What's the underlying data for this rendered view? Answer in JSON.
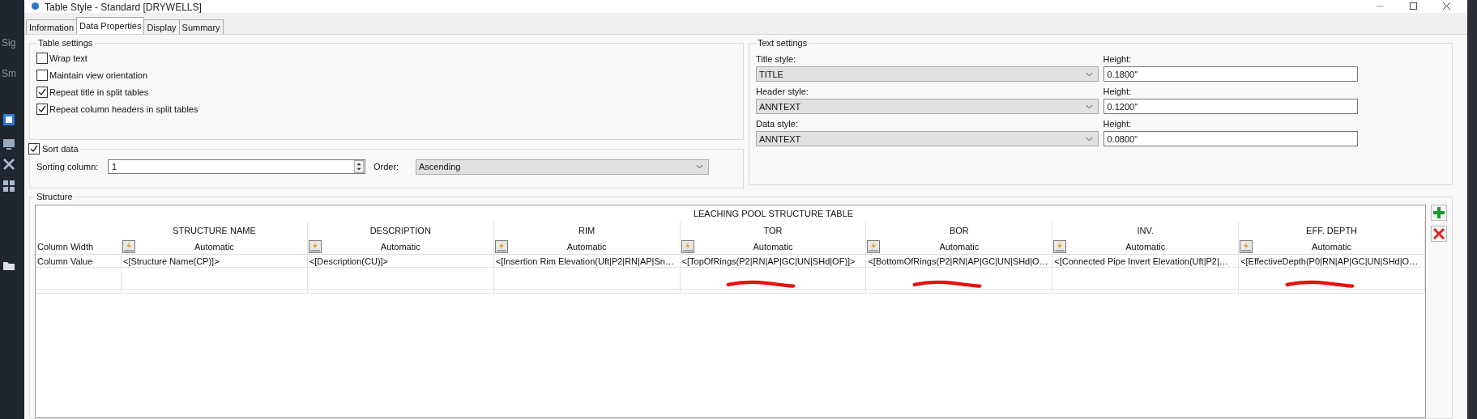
{
  "background_app": {
    "labels": [
      "Sig",
      "Sm"
    ]
  },
  "window": {
    "title": "Table Style - Standard [DRYWELLS]"
  },
  "tabs": [
    {
      "label": "Information",
      "selected": false
    },
    {
      "label": "Data Properties",
      "selected": true
    },
    {
      "label": "Display",
      "selected": false
    },
    {
      "label": "Summary",
      "selected": false
    }
  ],
  "table_settings": {
    "title": "Table settings",
    "options": [
      {
        "label": "Wrap text",
        "checked": false
      },
      {
        "label": "Maintain view orientation",
        "checked": false
      },
      {
        "label": "Repeat title in split tables",
        "checked": true
      },
      {
        "label": "Repeat column headers in split tables",
        "checked": true
      }
    ]
  },
  "sort_data": {
    "label": "Sort data",
    "checked": true,
    "sorting_column_label": "Sorting column:",
    "sorting_column": "1",
    "order_label": "Order:",
    "order": "Ascending"
  },
  "text_settings": {
    "title": "Text settings",
    "rows": [
      {
        "style_label": "Title style:",
        "style": "TITLE",
        "height_label": "Height:",
        "height": "0.1800\""
      },
      {
        "style_label": "Header style:",
        "style": "ANNTEXT",
        "height_label": "Height:",
        "height": "0.1200\""
      },
      {
        "style_label": "Data style:",
        "style": "ANNTEXT",
        "height_label": "Height:",
        "height": "0.0800\""
      }
    ]
  },
  "structure": {
    "title": "Structure",
    "table_title": "LEACHING POOL STRUCTURE TABLE",
    "row_labels": [
      "Column Width",
      "Column Value"
    ],
    "columns": [
      {
        "header": "STRUCTURE NAME",
        "width": "Automatic",
        "value": "<[Structure Name(CP)]>",
        "marked": false
      },
      {
        "header": "DESCRIPTION",
        "width": "Automatic",
        "value": "<[Description(CU)]>",
        "marked": false
      },
      {
        "header": "RIM",
        "width": "Automatic",
        "value": "<[Insertion Rim Elevation(Uft|P2|RN|AP|Sn…",
        "marked": false
      },
      {
        "header": "TOR",
        "width": "Automatic",
        "value": "<[TopOfRings(P2|RN|AP|GC|UN|SHd|OF)]>",
        "marked": true
      },
      {
        "header": "BOR",
        "width": "Automatic",
        "value": "<[BottomOfRings(P2|RN|AP|GC|UN|SHd|O…",
        "marked": true
      },
      {
        "header": "INV.",
        "width": "Automatic",
        "value": "<[Connected Pipe Invert Elevation(Uft|P2|…",
        "marked": false
      },
      {
        "header": "EFF. DEPTH",
        "width": "Automatic",
        "value": "<[EffectiveDepth(P0|RN|AP|GC|UN|SHd|O…",
        "marked": true
      }
    ]
  }
}
